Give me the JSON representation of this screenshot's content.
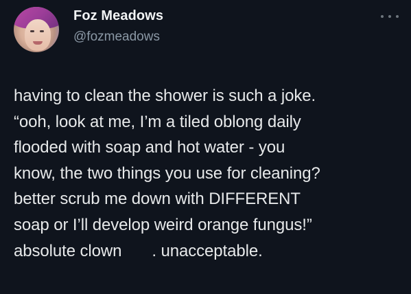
{
  "tweet": {
    "author": {
      "display_name": "Foz Meadows",
      "handle": "@fozmeadows"
    },
    "more_icon": "ellipsis-icon",
    "lines": [
      "having to clean the shower is such a joke.",
      "“ooh, look at me, I’m a tiled oblong daily",
      "flooded with soap and hot water - you",
      "know, the two things you use for cleaning?",
      "better scrub me down with DIFFERENT",
      "soap or I’ll develop weird orange fungus!”"
    ],
    "last_line": {
      "before": "absolute clown",
      "after": ". unacceptable."
    }
  },
  "colors": {
    "background": "#0f141d",
    "text": "#e7e9ea",
    "secondary_text": "#8b98a5",
    "avatar_hair": "#c04aa7"
  }
}
